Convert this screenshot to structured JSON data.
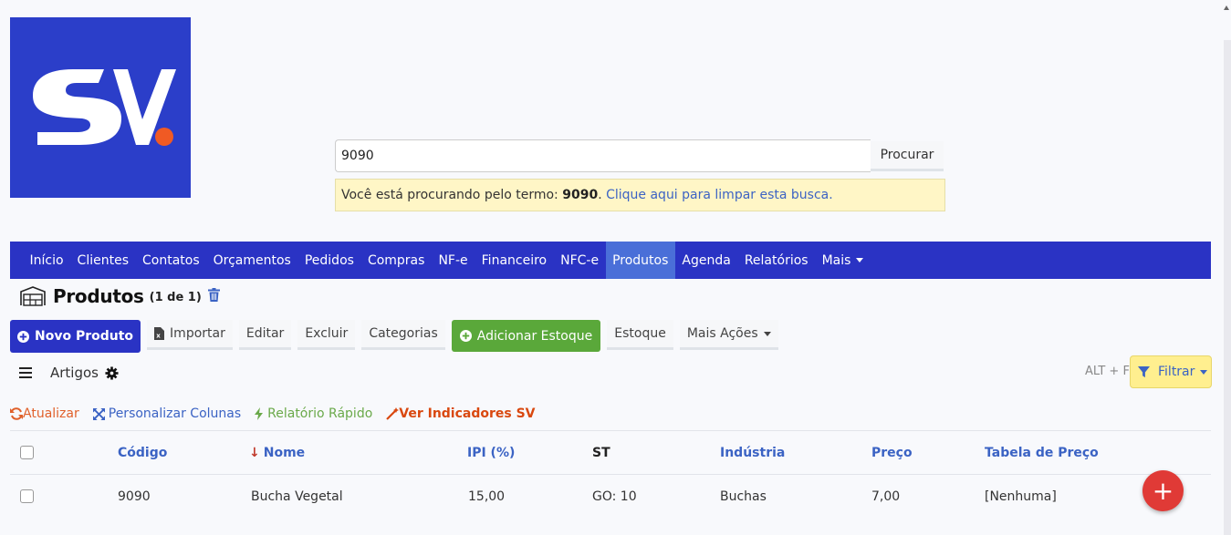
{
  "logo": {
    "text": "SV",
    "accent_color": "#f05a24",
    "bg_color": "#2b3ec9"
  },
  "search": {
    "value": "9090",
    "button_label": "Procurar"
  },
  "search_alert": {
    "prefix": "Você está procurando pelo termo: ",
    "term": "9090",
    "separator": ". ",
    "clear_link": "Clique aqui para limpar esta busca."
  },
  "nav": {
    "items": [
      "Início",
      "Clientes",
      "Contatos",
      "Orçamentos",
      "Pedidos",
      "Compras",
      "NF-e",
      "Financeiro",
      "NFC-e",
      "Produtos",
      "Agenda",
      "Relatórios"
    ],
    "more": "Mais",
    "active": "Produtos"
  },
  "page": {
    "title": "Produtos",
    "count": "(1 de 1)"
  },
  "toolbar": {
    "novo_produto": "Novo Produto",
    "importar": "Importar",
    "editar": "Editar",
    "excluir": "Excluir",
    "categorias": "Categorias",
    "adicionar_estoque": "Adicionar Estoque",
    "estoque": "Estoque",
    "mais_acoes": "Mais Ações"
  },
  "view": {
    "label": "Artigos",
    "shortcut": "ALT + F",
    "filter": "Filtrar"
  },
  "links": {
    "atualizar": "Atualizar",
    "personalizar": "Personalizar Colunas",
    "relatorio": "Relatório Rápido",
    "indicadores": "Ver Indicadores SV"
  },
  "table": {
    "headers": {
      "codigo": "Código",
      "nome": "Nome",
      "ipi": "IPI (%)",
      "st": "ST",
      "industria": "Indústria",
      "preco": "Preço",
      "tabela": "Tabela de Preço"
    },
    "rows": [
      {
        "codigo": "9090",
        "nome": "Bucha Vegetal",
        "ipi": "15,00",
        "st": "GO: 10",
        "industria": "Buchas",
        "preco": "7,00",
        "tabela": "[Nenhuma]"
      }
    ]
  },
  "fab": {
    "label": "+"
  }
}
